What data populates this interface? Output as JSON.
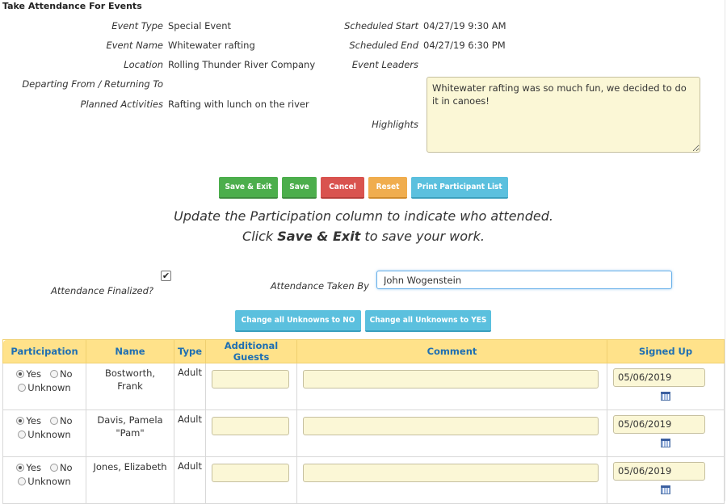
{
  "page": {
    "title": "Take Attendance For Events"
  },
  "event": {
    "type_label": "Event Type",
    "type": "Special Event",
    "name_label": "Event Name",
    "name": "Whitewater rafting",
    "location_label": "Location",
    "location": "Rolling Thunder River Company",
    "departing_label": "Departing From / Returning To",
    "departing": "",
    "activities_label": "Planned Activities",
    "activities": "Rafting with lunch on the river",
    "start_label": "Scheduled Start",
    "start": "04/27/19 9:30 AM",
    "end_label": "Scheduled End",
    "end": "04/27/19 6:30 PM",
    "leaders_label": "Event Leaders",
    "leaders": "",
    "highlights_label": "Highlights",
    "highlights": "Whitewater rafting was so much fun, we decided to do it in canoes!"
  },
  "buttons": {
    "save_exit": "Save & Exit",
    "save": "Save",
    "cancel": "Cancel",
    "reset": "Reset",
    "print": "Print Participant List",
    "unknown_no": "Change all Unknowns to NO",
    "unknown_yes": "Change all Unknowns to YES"
  },
  "instructions": {
    "line1": "Update the Participation column to indicate who attended.",
    "line2_pre": "Click ",
    "line2_bold": "Save & Exit",
    "line2_post": " to save your work."
  },
  "attendance": {
    "finalized_label": "Attendance Finalized?",
    "finalized": true,
    "taken_by_label": "Attendance Taken By",
    "taken_by": "John Wogenstein"
  },
  "table": {
    "headers": [
      "Participation",
      "Name",
      "Type",
      "Additional Guests",
      "Comment",
      "Signed Up"
    ],
    "options": {
      "yes": "Yes",
      "no": "No",
      "unknown": "Unknown"
    },
    "rows": [
      {
        "name_line1": "Bostworth,",
        "name_line2": "Frank",
        "type": "Adult",
        "selection": "Yes",
        "signed_up": "05/06/2019"
      },
      {
        "name_line1": "Davis, Pamela",
        "name_line2": "\"Pam\"",
        "type": "Adult",
        "selection": "Yes",
        "signed_up": "05/06/2019"
      },
      {
        "name_line1": "Jones, Elizabeth",
        "name_line2": "",
        "type": "Adult",
        "selection": "Yes",
        "signed_up": "05/06/2019"
      }
    ]
  },
  "colors": {
    "header_bg": "#ffe28a",
    "header_text": "#1f6fb2",
    "field_bg": "#fbf7d6",
    "green": "#4cae4c",
    "red": "#d9534f",
    "orange": "#f0ad4e",
    "blue": "#5bc0de"
  }
}
